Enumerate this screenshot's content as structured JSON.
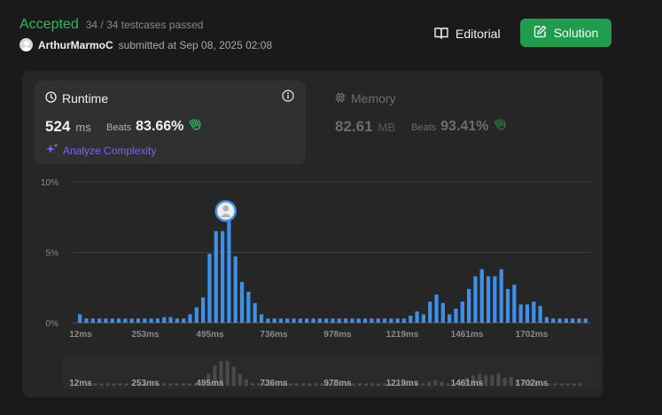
{
  "header": {
    "status": "Accepted",
    "testcases": "34 / 34 testcases passed",
    "username": "ArthurMarmoC",
    "submitted_at": "submitted at Sep 08, 2025 02:08"
  },
  "actions": {
    "editorial_label": "Editorial",
    "solution_label": "Solution"
  },
  "runtime": {
    "title": "Runtime",
    "value": "524",
    "unit": "ms",
    "beats_label": "Beats",
    "beats": "83.66%",
    "analyze_label": "Analyze Complexity"
  },
  "memory": {
    "title": "Memory",
    "value": "82.61",
    "unit": "MB",
    "beats_label": "Beats",
    "beats": "93.41%"
  },
  "colors": {
    "accent_green": "#2cbb5d",
    "bar_blue": "#3e8fe8",
    "analyze_purple": "#7b61ff",
    "hands_green": "#2cbb5d"
  },
  "chart_data": {
    "type": "bar",
    "title": "",
    "xlabel": "",
    "ylabel": "",
    "ylim": [
      0,
      10
    ],
    "yticks": [
      "0%",
      "5%",
      "10%"
    ],
    "yunit": "%",
    "xticks": [
      "12ms",
      "253ms",
      "495ms",
      "736ms",
      "978ms",
      "1219ms",
      "1461ms",
      "1702ms"
    ],
    "user_bar_index": 24,
    "values": [
      0.6,
      0.3,
      0.3,
      0.3,
      0.3,
      0.3,
      0.3,
      0.3,
      0.3,
      0.3,
      0.3,
      0.3,
      0.3,
      0.4,
      0.4,
      0.3,
      0.3,
      0.6,
      1.1,
      1.8,
      4.9,
      6.5,
      6.5,
      7.5,
      4.7,
      2.9,
      2.2,
      1.4,
      0.6,
      0.3,
      0.3,
      0.3,
      0.3,
      0.3,
      0.3,
      0.3,
      0.3,
      0.3,
      0.3,
      0.3,
      0.3,
      0.3,
      0.3,
      0.3,
      0.3,
      0.3,
      0.3,
      0.3,
      0.3,
      0.3,
      0.3,
      0.5,
      0.8,
      0.6,
      1.5,
      2.0,
      1.4,
      0.6,
      1.0,
      1.5,
      2.4,
      3.3,
      3.8,
      3.3,
      3.3,
      3.8,
      2.4,
      2.7,
      1.3,
      1.3,
      1.5,
      1.2,
      0.4,
      0.3,
      0.3,
      0.3,
      0.3,
      0.3,
      0.3
    ],
    "navigator_values": [
      0.3,
      0.3,
      0.3,
      0.3,
      0.3,
      0.3,
      0.3,
      0.3,
      0.3,
      0.3,
      0.3,
      0.3,
      0.3,
      0.3,
      0.3,
      0.3,
      0.3,
      0.3,
      0.3,
      1.5,
      2.5,
      3.1,
      3.1,
      2.4,
      1.5,
      0.8,
      0.3,
      0.3,
      0.3,
      0.3,
      0.3,
      0.3,
      0.3,
      0.3,
      0.3,
      0.3,
      0.3,
      0.3,
      0.3,
      0.3,
      0.3,
      0.3,
      0.3,
      0.3,
      0.3,
      0.3,
      0.3,
      0.3,
      0.3,
      0.3,
      0.3,
      0.3,
      0.3,
      0.3,
      0.5,
      0.7,
      0.5,
      0.3,
      0.3,
      0.5,
      1.0,
      1.3,
      1.5,
      1.3,
      1.3,
      1.5,
      1.0,
      1.1,
      0.6,
      0.6,
      0.6,
      0.5,
      0.3,
      0.3,
      0.3,
      0.3,
      0.3,
      0.3,
      0.3
    ]
  }
}
